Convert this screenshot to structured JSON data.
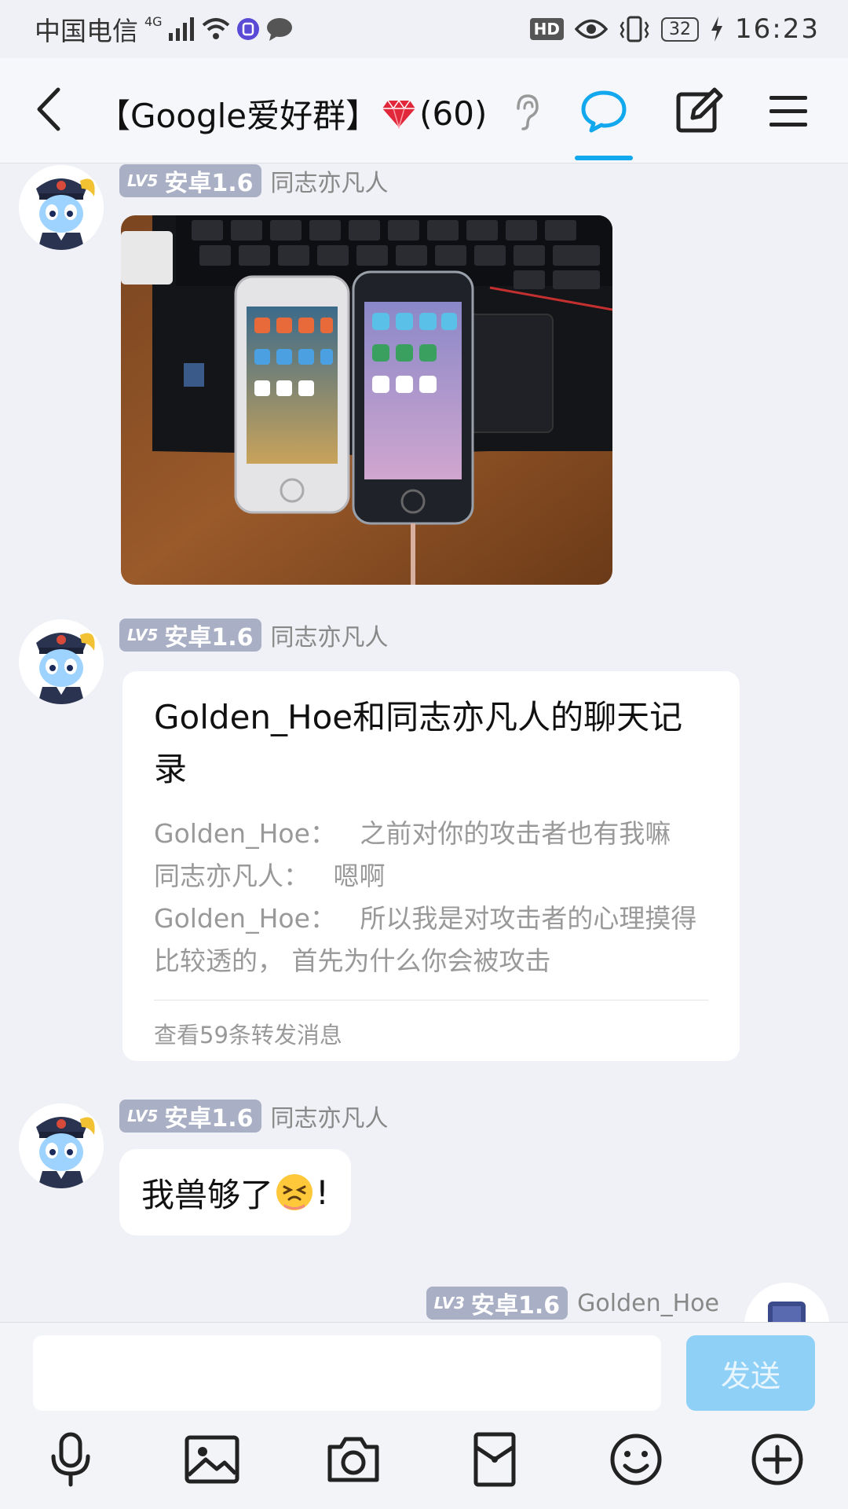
{
  "status_bar": {
    "carrier": "中国电信",
    "network": "4G",
    "hd": "HD",
    "battery": "32",
    "time": "16:23"
  },
  "header": {
    "title_prefix": "【Google爱好群】",
    "title_count": "(60)"
  },
  "messages": [
    {
      "level_code": "LV5",
      "level_name": "安卓1.6",
      "sender": "同志亦凡人",
      "type": "image"
    },
    {
      "level_code": "LV5",
      "level_name": "安卓1.6",
      "sender": "同志亦凡人",
      "type": "forward",
      "forward_title": "Golden_Hoe和同志亦凡人的聊天记录",
      "forward_lines": [
        {
          "name": "Golden_Hoe：",
          "text": "之前对你的攻击者也有我嘛"
        },
        {
          "name": "同志亦凡人：",
          "text": "嗯啊"
        },
        {
          "name": "Golden_Hoe：",
          "text": "所以我是对攻击者的心理摸得比较透的， 首先为什么你会被攻击"
        }
      ],
      "forward_footer": "查看59条转发消息"
    },
    {
      "level_code": "LV5",
      "level_name": "安卓1.6",
      "sender": "同志亦凡人",
      "type": "text",
      "text_before": "我兽够了",
      "text_after": "!"
    },
    {
      "level_code": "LV3",
      "level_name": "安卓1.6",
      "sender": "Golden_Hoe",
      "type": "self"
    }
  ],
  "input": {
    "value": "",
    "send_label": "发送"
  },
  "colors": {
    "accent": "#12a8ee",
    "send_disabled": "#8fd0f7",
    "badge": "#a9afc4"
  }
}
